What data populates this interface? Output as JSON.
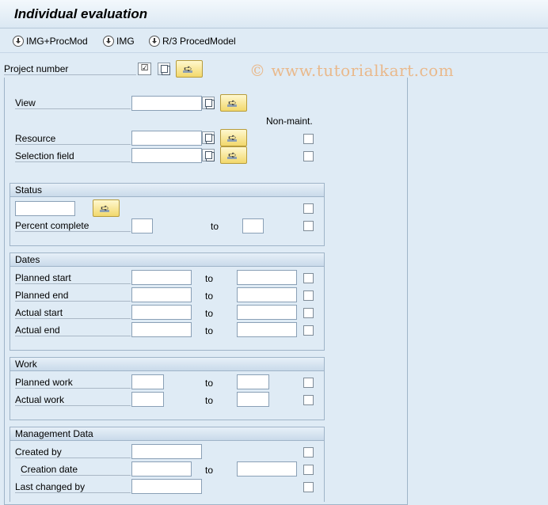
{
  "window": {
    "title": "Individual evaluation"
  },
  "toolbar": {
    "buttons": [
      {
        "label": "IMG+ProcMod",
        "icon": "download-icon"
      },
      {
        "label": "IMG",
        "icon": "download-icon"
      },
      {
        "label": "R/3 ProcedModel",
        "icon": "download-icon"
      }
    ],
    "watermark": "© www.tutorialkart.com"
  },
  "project": {
    "label": "Project number",
    "checked_glyph": "☑"
  },
  "top_fields": {
    "view_label": "View",
    "non_maint_header": "Non-maint.",
    "resource_label": "Resource",
    "selection_field_label": "Selection field"
  },
  "status": {
    "header": "Status",
    "percent_complete_label": "Percent complete",
    "to_label": "to"
  },
  "dates": {
    "header": "Dates",
    "rows": [
      {
        "label": "Planned start",
        "to": "to"
      },
      {
        "label": "Planned end",
        "to": "to"
      },
      {
        "label": "Actual start",
        "to": "to"
      },
      {
        "label": "Actual end",
        "to": "to"
      }
    ]
  },
  "work": {
    "header": "Work",
    "rows": [
      {
        "label": "Planned work",
        "to": "to"
      },
      {
        "label": "Actual work",
        "to": "to"
      }
    ]
  },
  "management": {
    "header": "Management Data",
    "created_by_label": "Created by",
    "creation_date_label": "Creation date",
    "to_label": "to",
    "last_changed_by_label": "Last changed by"
  },
  "arrow_glyph": "➪"
}
